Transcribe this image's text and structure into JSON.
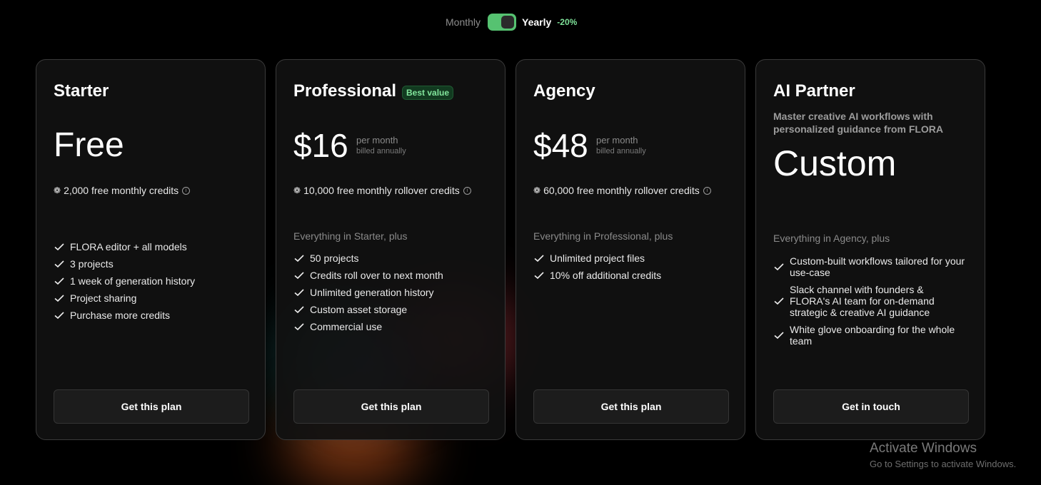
{
  "billing_toggle": {
    "monthly": "Monthly",
    "yearly": "Yearly",
    "discount": "-20%",
    "yearly_selected": true
  },
  "plans": [
    {
      "name": "Starter",
      "price": "Free",
      "credits": "2,000 free monthly credits",
      "features": [
        "FLORA editor + all models",
        "3 projects",
        "1 week of generation history",
        "Project sharing",
        "Purchase more credits"
      ],
      "cta": "Get this plan"
    },
    {
      "name": "Professional",
      "badge": "Best value",
      "price": "$16",
      "per": "per month",
      "billed": "billed annually",
      "credits": "10,000 free monthly rollover credits",
      "intro": "Everything in Starter, plus",
      "features": [
        "50 projects",
        "Credits roll over to next month",
        "Unlimited generation history",
        "Custom asset storage",
        "Commercial use"
      ],
      "cta": "Get this plan"
    },
    {
      "name": "Agency",
      "price": "$48",
      "per": "per month",
      "billed": "billed annually",
      "credits": "60,000 free monthly rollover credits",
      "intro": "Everything in Professional, plus",
      "features": [
        "Unlimited project files",
        "10% off additional credits"
      ],
      "cta": "Get this plan"
    },
    {
      "name": "AI Partner",
      "description": "Master creative AI workflows with personalized guidance from FLORA",
      "price": "Custom",
      "intro": "Everything in Agency, plus",
      "features": [
        "Custom-built workflows tailored for your use-case",
        "Slack channel with founders & FLORA's AI team for on-demand strategic & creative AI guidance",
        "White glove onboarding for the whole team"
      ],
      "cta": "Get in touch"
    }
  ],
  "credit_icon": "flower-credit-icon",
  "watermark": {
    "title": "Activate Windows",
    "subtitle": "Go to Settings to activate Windows."
  }
}
